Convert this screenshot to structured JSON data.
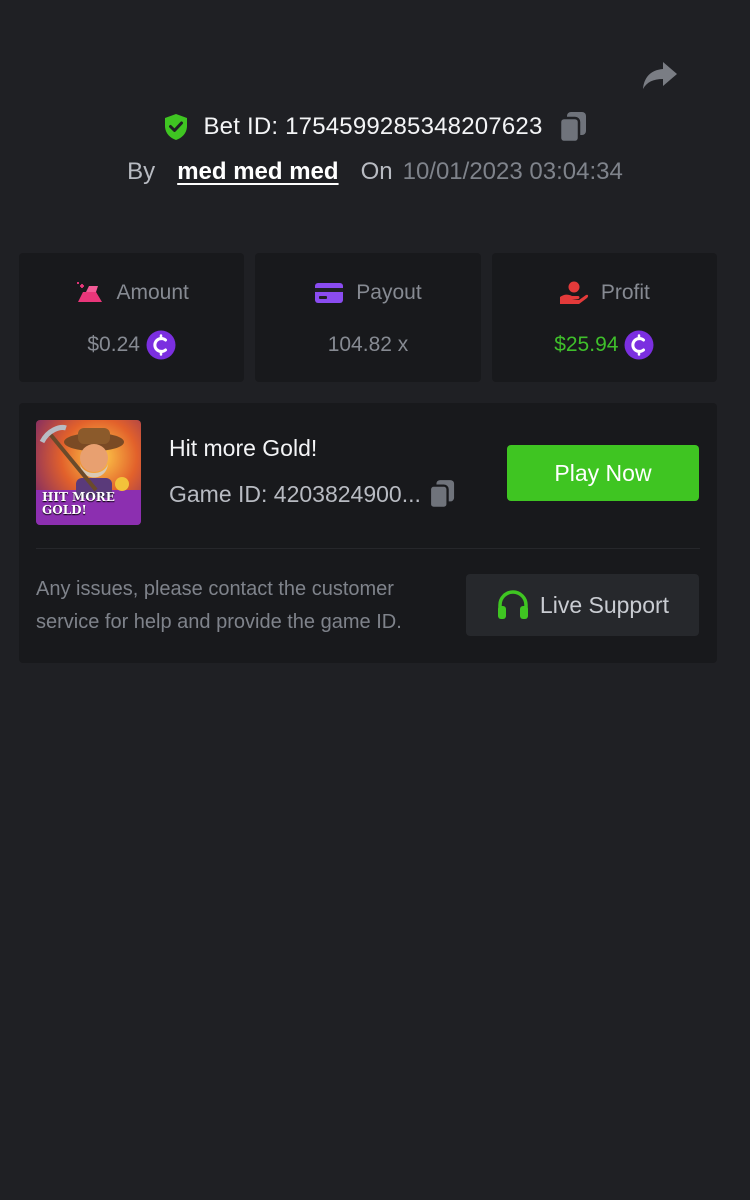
{
  "header": {
    "bet_id_text": "Bet ID: 1754599285348207623",
    "by_label": "By",
    "username": "med med med",
    "on_label": "On",
    "datetime": "10/01/2023 03:04:34"
  },
  "stats": [
    {
      "label": "Amount",
      "value": "$0.24",
      "icon": "gold-bar-icon",
      "has_coin": true
    },
    {
      "label": "Payout",
      "value": "104.82 x",
      "icon": "card-icon",
      "has_coin": false
    },
    {
      "label": "Profit",
      "value": "$25.94",
      "icon": "hand-coin-icon",
      "has_coin": true
    }
  ],
  "game": {
    "title": "Hit more Gold!",
    "game_id_text": "Game ID: 4203824900...",
    "thumb_text_line1": "HIT MORE",
    "thumb_text_line2": "GOLD!",
    "play_label": "Play Now"
  },
  "support": {
    "help_text": "Any issues, please contact the customer service for help and provide the game ID.",
    "button_label": "Live Support"
  },
  "colors": {
    "background": "#1f2024",
    "card": "#18191c",
    "accent_green": "#3fc522",
    "profit_green": "#3fbf2b",
    "coin_purple": "#7b2fe0",
    "amount_pink": "#e8367a",
    "payout_purple": "#8a4cf0",
    "profit_red": "#e33a3a"
  }
}
